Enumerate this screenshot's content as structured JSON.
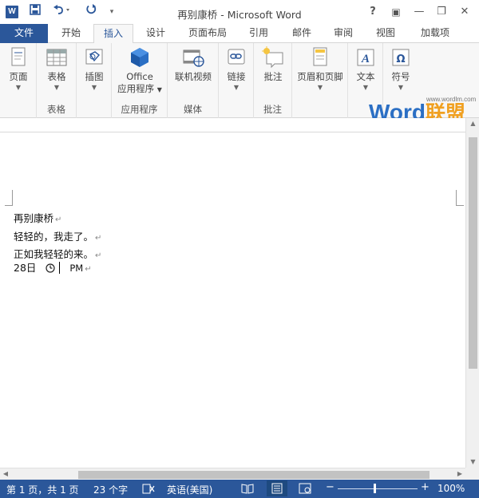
{
  "app": {
    "title": "再别康桥 - Microsoft Word",
    "logo_letter": "W",
    "quick_access": [
      "save-icon",
      "undo-icon",
      "redo-icon",
      "customize-icon"
    ],
    "window_controls": {
      "help": "?",
      "ribbon_options": "▣",
      "minimize": "—",
      "restore": "❐",
      "close": "✕"
    }
  },
  "tabs": {
    "file": "文件",
    "items": [
      "开始",
      "插入",
      "设计",
      "页面布局",
      "引用",
      "邮件",
      "审阅",
      "视图",
      "加载项"
    ],
    "active": "插入"
  },
  "ribbon": {
    "groups": [
      {
        "label": "",
        "buttons": [
          {
            "label": "页面",
            "icon": "pages-icon"
          }
        ]
      },
      {
        "label": "表格",
        "buttons": [
          {
            "label": "表格",
            "icon": "table-icon"
          }
        ]
      },
      {
        "label": "",
        "buttons": [
          {
            "label": "插图",
            "icon": "illustrations-icon"
          }
        ]
      },
      {
        "label": "应用程序",
        "buttons": [
          {
            "label": "Office",
            "label2": "应用程序",
            "icon": "office-apps-icon"
          }
        ]
      },
      {
        "label": "媒体",
        "buttons": [
          {
            "label": "联机视频",
            "icon": "online-video-icon"
          }
        ]
      },
      {
        "label": "",
        "buttons": [
          {
            "label": "链接",
            "icon": "links-icon"
          }
        ]
      },
      {
        "label": "批注",
        "buttons": [
          {
            "label": "批注",
            "icon": "comment-icon"
          }
        ]
      },
      {
        "label": "",
        "buttons": [
          {
            "label": "页眉和页脚",
            "icon": "header-footer-icon"
          }
        ]
      },
      {
        "label": "",
        "buttons": [
          {
            "label": "文本",
            "icon": "text-icon"
          }
        ]
      },
      {
        "label": "",
        "buttons": [
          {
            "label": "符号",
            "icon": "symbols-icon"
          }
        ]
      }
    ]
  },
  "watermark": {
    "url": "www.wordlm.com",
    "brand_left": "Word",
    "brand_right": "联盟"
  },
  "document": {
    "lines": [
      "再别康桥",
      "轻轻的，我走了。",
      "正如我轻轻的来。"
    ],
    "line4": {
      "date": "28日",
      "time_suffix": "PM"
    },
    "paragraph_mark": "↵"
  },
  "status": {
    "page": "第 1 页，共 1 页",
    "words": "23 个字",
    "language": "英语(美国)",
    "zoom": "100%",
    "zoom_minus": "−",
    "zoom_plus": "+"
  },
  "colors": {
    "accent": "#2b579a",
    "watermark_orange": "#f0a020"
  }
}
